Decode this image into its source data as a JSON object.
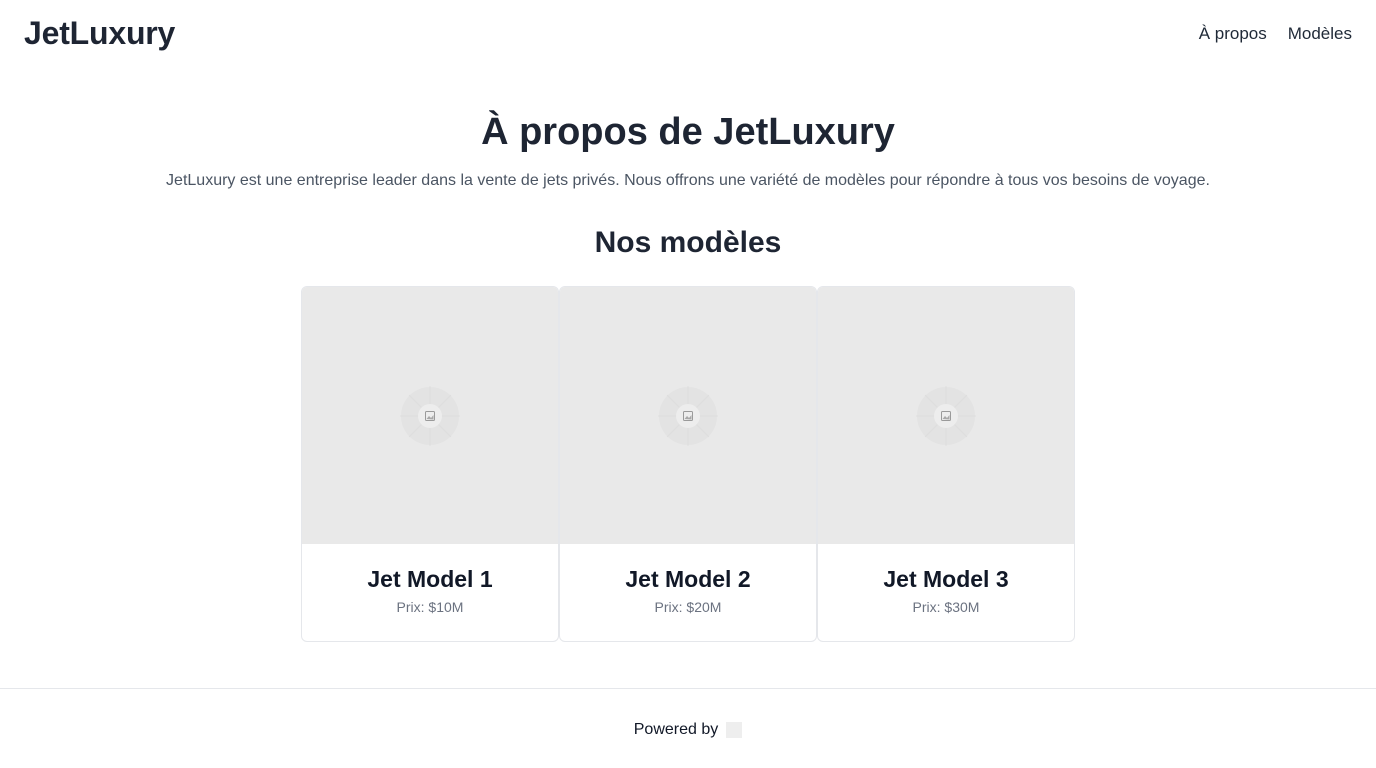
{
  "header": {
    "brand": "JetLuxury",
    "nav": [
      {
        "label": "À propos"
      },
      {
        "label": "Modèles"
      }
    ]
  },
  "about": {
    "title": "À propos de JetLuxury",
    "description": "JetLuxury est une entreprise leader dans la vente de jets privés. Nous offrons une variété de modèles pour répondre à tous vos besoins de voyage."
  },
  "models": {
    "title": "Nos modèles",
    "items": [
      {
        "name": "Jet Model 1",
        "price": "Prix: $10M",
        "icon": "image-placeholder-icon"
      },
      {
        "name": "Jet Model 2",
        "price": "Prix: $20M",
        "icon": "image-placeholder-icon"
      },
      {
        "name": "Jet Model 3",
        "price": "Prix: $30M",
        "icon": "image-placeholder-icon"
      }
    ]
  },
  "footer": {
    "powered_label": "Powered by",
    "logo_icon": "logo-placeholder-icon"
  }
}
